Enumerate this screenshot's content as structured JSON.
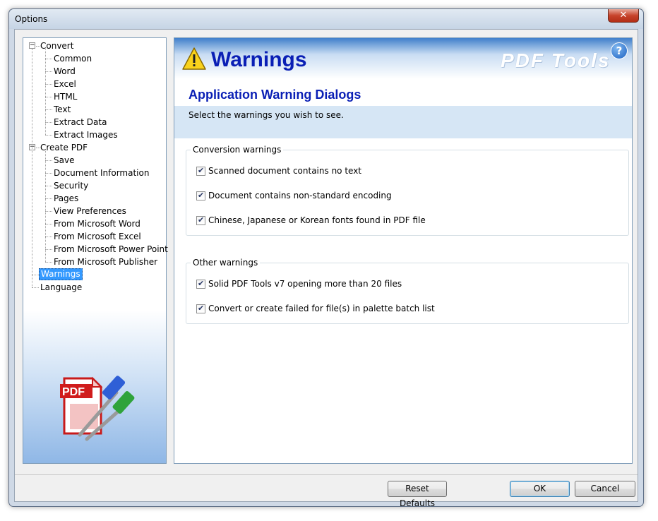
{
  "window": {
    "title": "Options",
    "close_glyph": "✕"
  },
  "tree": {
    "groups": [
      {
        "label": "Convert",
        "expander": "−",
        "children": [
          "Common",
          "Word",
          "Excel",
          "HTML",
          "Text",
          "Extract Data",
          "Extract Images"
        ]
      },
      {
        "label": "Create PDF",
        "expander": "−",
        "children": [
          "Save",
          "Document Information",
          "Security",
          "Pages",
          "View Preferences",
          "From Microsoft Word",
          "From Microsoft Excel",
          "From Microsoft Power Point",
          "From Microsoft Publisher"
        ]
      }
    ],
    "leaves": [
      "Warnings",
      "Language"
    ],
    "selected": "Warnings"
  },
  "logo": {
    "text": "PDF",
    "icon": "pdf-tools-logo-icon"
  },
  "header": {
    "title": "Warnings",
    "icon": "warning-icon",
    "brand": "PDF Tools",
    "help_glyph": "?"
  },
  "section": {
    "title": "Application Warning Dialogs",
    "description": "Select the warnings you wish to see."
  },
  "groups": {
    "conversion": {
      "legend": "Conversion warnings",
      "items": [
        {
          "label": "Scanned document contains no text",
          "checked": true
        },
        {
          "label": "Document contains non-standard encoding",
          "checked": true
        },
        {
          "label": "Chinese, Japanese or Korean fonts found in PDF file",
          "checked": true
        }
      ]
    },
    "other": {
      "legend": "Other warnings",
      "items": [
        {
          "label": "Solid PDF Tools v7 opening more than 20 files",
          "checked": true
        },
        {
          "label": "Convert or create failed for file(s) in palette batch list",
          "checked": true
        }
      ]
    }
  },
  "buttons": {
    "reset": "Reset Defaults",
    "ok": "OK",
    "cancel": "Cancel"
  },
  "colors": {
    "title_blue": "#0a1fb5",
    "selection": "#3399ff",
    "band": "#d6e6f5"
  }
}
